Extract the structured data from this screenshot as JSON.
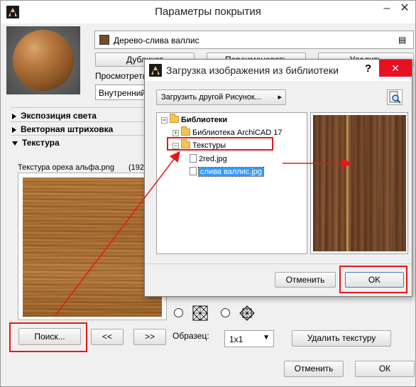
{
  "main_window": {
    "title": "Параметры покрытия",
    "minimize": "–",
    "close": "✕",
    "material_name": "Дерево-слива валлис",
    "material_color": "#7a4a2a",
    "btn_duplicate": "Дубликат",
    "btn_rename": "Переименовать",
    "btn_delete": "Удалить",
    "preview_label": "Просмотреть",
    "preview_select": "Внутренний",
    "sections": {
      "light": "Экспозиция света",
      "hatch": "Векторная штриховка",
      "texture": "Текстура"
    },
    "texture_filename": "Текстура ореха альфа.png",
    "texture_size": "(192",
    "btn_search": "Поиск...",
    "btn_prev": "<<",
    "btn_next": ">>",
    "sample_label": "Образец:",
    "sample_value": "1x1",
    "btn_remove_texture": "Удалить текстуру",
    "btn_cancel": "Отменить",
    "btn_ok": "ОК"
  },
  "library_dialog": {
    "title": "Загрузка изображения из библиотеки",
    "help": "?",
    "close": "✕",
    "load_other_button": "Загрузить другой Рисунок...",
    "tree": [
      {
        "label": "Библиотеки",
        "bold": true
      },
      {
        "label": "Библиотека ArchiCAD 17"
      },
      {
        "label": "Текстуры"
      },
      {
        "label": "2red.jpg"
      },
      {
        "label": "слива валлис.jpg",
        "selected": true
      }
    ],
    "btn_cancel": "Отменить",
    "btn_ok": "OK"
  },
  "colors": {
    "accent_red": "#e01a1a",
    "selection_blue": "#3399ff",
    "close_red": "#e81123"
  },
  "icons": {
    "library_view": "magnifier-document-icon",
    "mode_a": "crosshatch-square-icon",
    "mode_b": "crosshatch-diamond-icon"
  }
}
